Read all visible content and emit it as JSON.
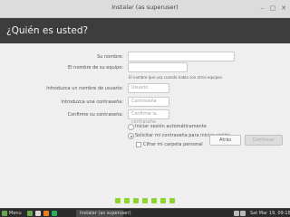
{
  "window": {
    "title": "Instalar (as superuser)",
    "minimize_icon": "minimize-icon",
    "maximize_icon": "maximize-icon",
    "close_icon": "close-icon"
  },
  "header": {
    "title": "¿Quién es usted?"
  },
  "form": {
    "name": {
      "label": "Su nombre:",
      "value": ""
    },
    "computer": {
      "label": "El nombre de su equipo:",
      "value": "",
      "hint": "El nombre que usa cuando habla con otros equipos."
    },
    "username": {
      "label": "Introduzca un nombre de usuario:",
      "placeholder": "Usuario"
    },
    "password": {
      "label": "Introduzca una contraseña:",
      "placeholder": "Contraseña"
    },
    "confirm": {
      "label": "Confirme su contraseña:",
      "placeholder": "Confirme la contraseña"
    },
    "options": {
      "auto_login": "Iniciar sesión automáticamente",
      "require_password": "Solicitar mi contraseña para iniciar sesión",
      "encrypt_home": "Cifrar mi carpeta personal"
    }
  },
  "buttons": {
    "back": "Atrás",
    "continue": "Continuar"
  },
  "progress": {
    "steps": 7,
    "color": "#8cd52b"
  },
  "taskbar": {
    "menu": "Menu",
    "active_app": "Instalar (as superuser)",
    "clock": "Sat Mar 19, 09:18"
  }
}
